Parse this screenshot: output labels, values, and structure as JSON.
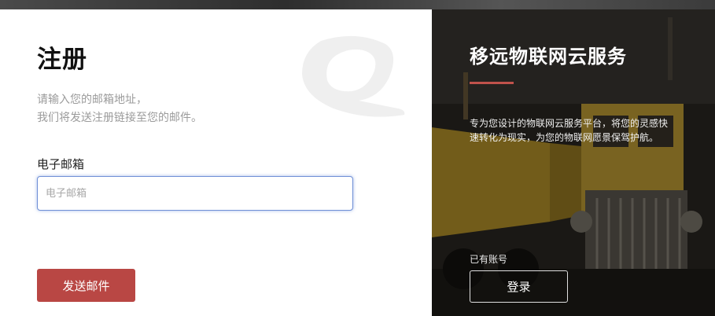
{
  "register": {
    "title": "注册",
    "desc_line1": "请输入您的邮箱地址，",
    "desc_line2": "我们将发送注册链接至您的邮件。",
    "email_label": "电子邮箱",
    "email_placeholder": "电子邮箱",
    "email_value": "",
    "send_button": "发送邮件"
  },
  "promo": {
    "title": "移远物联网云服务",
    "description": "专为您设计的物联网云服务平台，将您的灵感快速转化为现实，为您的物联网愿景保驾护航。",
    "have_account": "已有账号",
    "login_button": "登录"
  },
  "icons": {
    "watermark": "brand-logo-watermark-icon"
  },
  "colors": {
    "primary_button": "#b94744",
    "accent_line": "#c0524b",
    "input_focus_border": "#6f8fd6"
  }
}
